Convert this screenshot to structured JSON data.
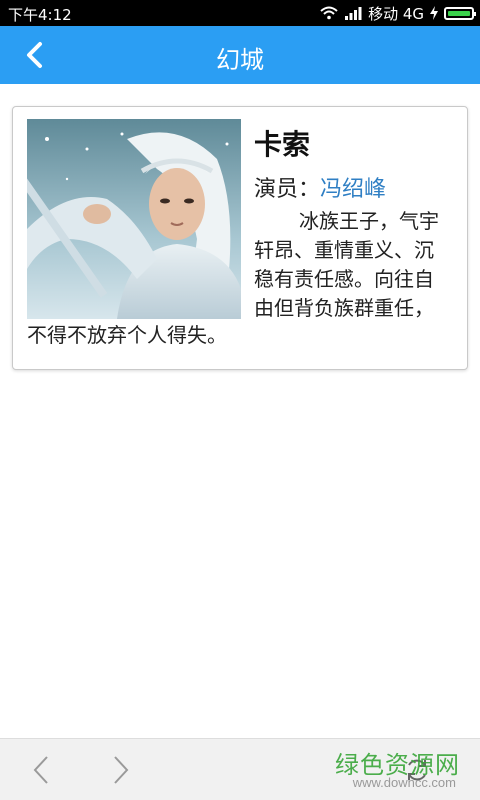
{
  "status_bar": {
    "time": "下午4:12",
    "carrier": "移动 4G"
  },
  "app_bar": {
    "title": "幻城",
    "back_icon": "chevron-left-icon"
  },
  "character": {
    "name": "卡索",
    "actor_label": "演员：",
    "actor_name": "冯绍峰",
    "description_lines": [
      "冰族王子，气宇",
      "轩昂、重情重义、沉",
      "稳有责任感。向往自",
      "由但背负族群重任，"
    ],
    "description_last_line": "不得不放弃个人得失。"
  },
  "bottom_bar": {
    "prev_icon": "chevron-left-icon",
    "next_icon": "chevron-right-icon",
    "refresh_icon": "refresh-icon",
    "watermark_main": "绿色资源网",
    "watermark_sub": "www.downcc.com"
  },
  "colors": {
    "app_bar": "#2b9ef3",
    "actor_link": "#2f7fc4",
    "watermark": "#3aa63a"
  }
}
